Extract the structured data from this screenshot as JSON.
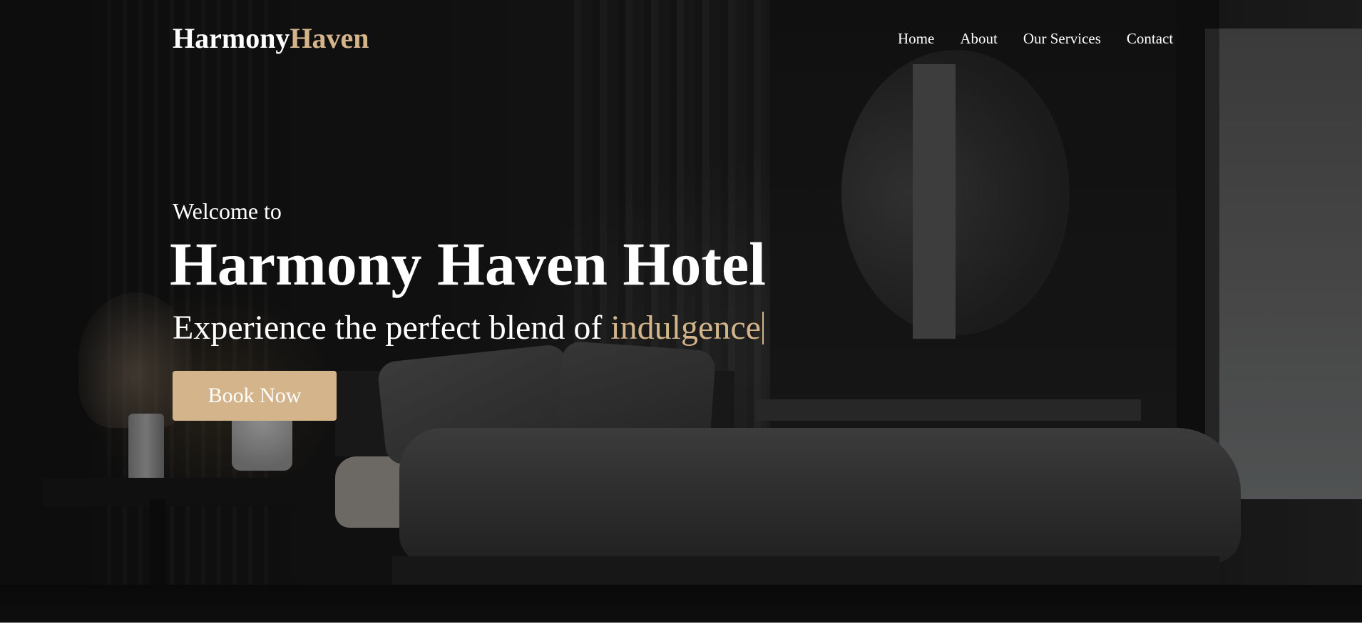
{
  "header": {
    "logo_main": "Harmony",
    "logo_accent": "Haven",
    "nav": {
      "home": "Home",
      "about": "About",
      "services": "Our Services",
      "contact": "Contact"
    }
  },
  "hero": {
    "welcome": "Welcome to",
    "title": "Harmony Haven Hotel",
    "tagline_prefix": "Experience the perfect blend of ",
    "tagline_typed": "indulgence",
    "cta_label": "Book Now",
    "background_image": "dark-luxury-hotel-bedroom"
  },
  "colors": {
    "accent": "#d4b48a",
    "text": "#ffffff",
    "overlay": "#000000"
  }
}
